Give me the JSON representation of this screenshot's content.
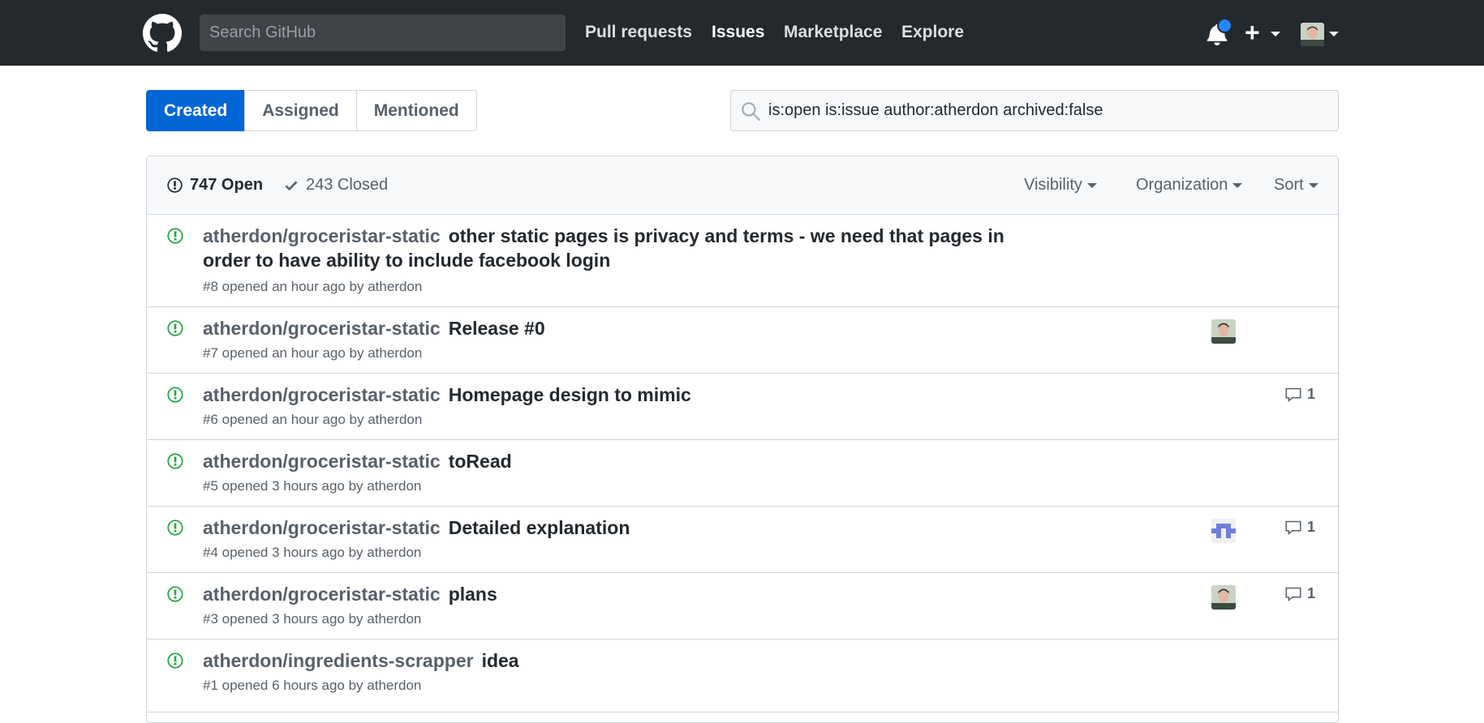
{
  "header": {
    "search_placeholder": "Search GitHub",
    "nav": [
      "Pull requests",
      "Issues",
      "Marketplace",
      "Explore"
    ],
    "active_nav": "Issues"
  },
  "subnav": [
    "Created",
    "Assigned",
    "Mentioned"
  ],
  "selected_subnav": "Created",
  "filter_query": "is:open is:issue author:atherdon archived:false",
  "counts": {
    "open": "747 Open",
    "closed": "243 Closed"
  },
  "menus": {
    "visibility": "Visibility",
    "organization": "Organization",
    "sort": "Sort"
  },
  "issues": [
    {
      "repo": "atherdon/groceristar-static",
      "title": "other static pages is privacy and terms - we need that pages in order to have ability to include facebook login",
      "meta": "#8 opened an hour ago by atherdon",
      "assignee": "",
      "comments": ""
    },
    {
      "repo": "atherdon/groceristar-static",
      "title": "Release #0",
      "meta": "#7 opened an hour ago by atherdon",
      "assignee": "atherdon-photo",
      "comments": ""
    },
    {
      "repo": "atherdon/groceristar-static",
      "title": "Homepage design to mimic",
      "meta": "#6 opened an hour ago by atherdon",
      "assignee": "",
      "comments": "1"
    },
    {
      "repo": "atherdon/groceristar-static",
      "title": "toRead",
      "meta": "#5 opened 3 hours ago by atherdon",
      "assignee": "",
      "comments": ""
    },
    {
      "repo": "atherdon/groceristar-static",
      "title": "Detailed explanation",
      "meta": "#4 opened 3 hours ago by atherdon",
      "assignee": "identicon",
      "comments": "1"
    },
    {
      "repo": "atherdon/groceristar-static",
      "title": "plans",
      "meta": "#3 opened 3 hours ago by atherdon",
      "assignee": "atherdon-photo",
      "comments": "1"
    },
    {
      "repo": "atherdon/ingredients-scrapper",
      "title": "idea",
      "meta": "#1 opened 6 hours ago by atherdon",
      "assignee": "",
      "comments": ""
    }
  ],
  "colors": {
    "header_bg": "#24292e",
    "accent": "#0366d6",
    "open_green": "#28a745",
    "notification": "#2188ff"
  },
  "icons": [
    "github-mark-icon",
    "bell-icon",
    "plus-icon",
    "search-icon",
    "issue-opened-icon",
    "check-icon",
    "comment-icon"
  ]
}
